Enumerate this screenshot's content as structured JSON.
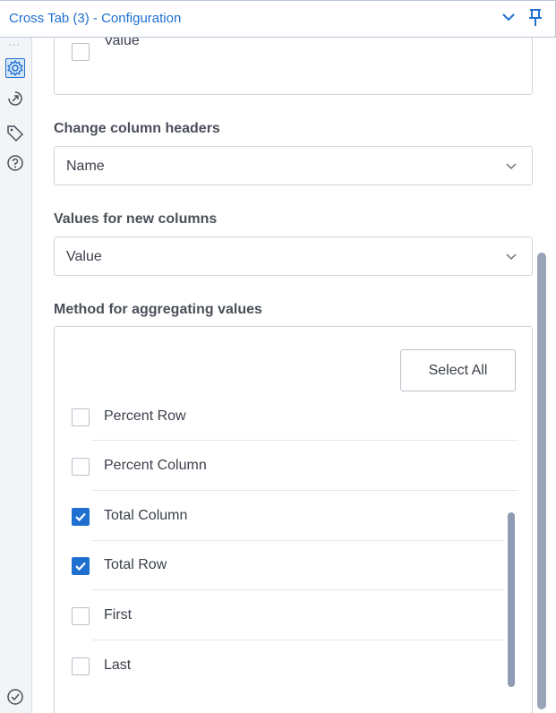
{
  "window": {
    "title": "Cross Tab (3) - Configuration"
  },
  "colors": {
    "accent": "#1f6fd1",
    "border": "#cfd4db"
  },
  "siderail": {
    "icons": [
      "more-dots",
      "gear-icon",
      "arrow-circle-icon",
      "tag-icon",
      "help-icon"
    ],
    "bottom_icon": "check-circle-icon"
  },
  "group_by": {
    "partial_item": {
      "label": "Value",
      "checked": false
    }
  },
  "change_column_headers": {
    "label": "Change column headers",
    "value": "Name"
  },
  "values_for_new_columns": {
    "label": "Values for new columns",
    "value": "Value"
  },
  "aggregation": {
    "label": "Method for aggregating values",
    "select_all_label": "Select All",
    "items": [
      {
        "label": "Percent Row",
        "checked": false
      },
      {
        "label": "Percent Column",
        "checked": false
      },
      {
        "label": "Total Column",
        "checked": true
      },
      {
        "label": "Total Row",
        "checked": true
      },
      {
        "label": "First",
        "checked": false
      },
      {
        "label": "Last",
        "checked": false
      }
    ]
  }
}
